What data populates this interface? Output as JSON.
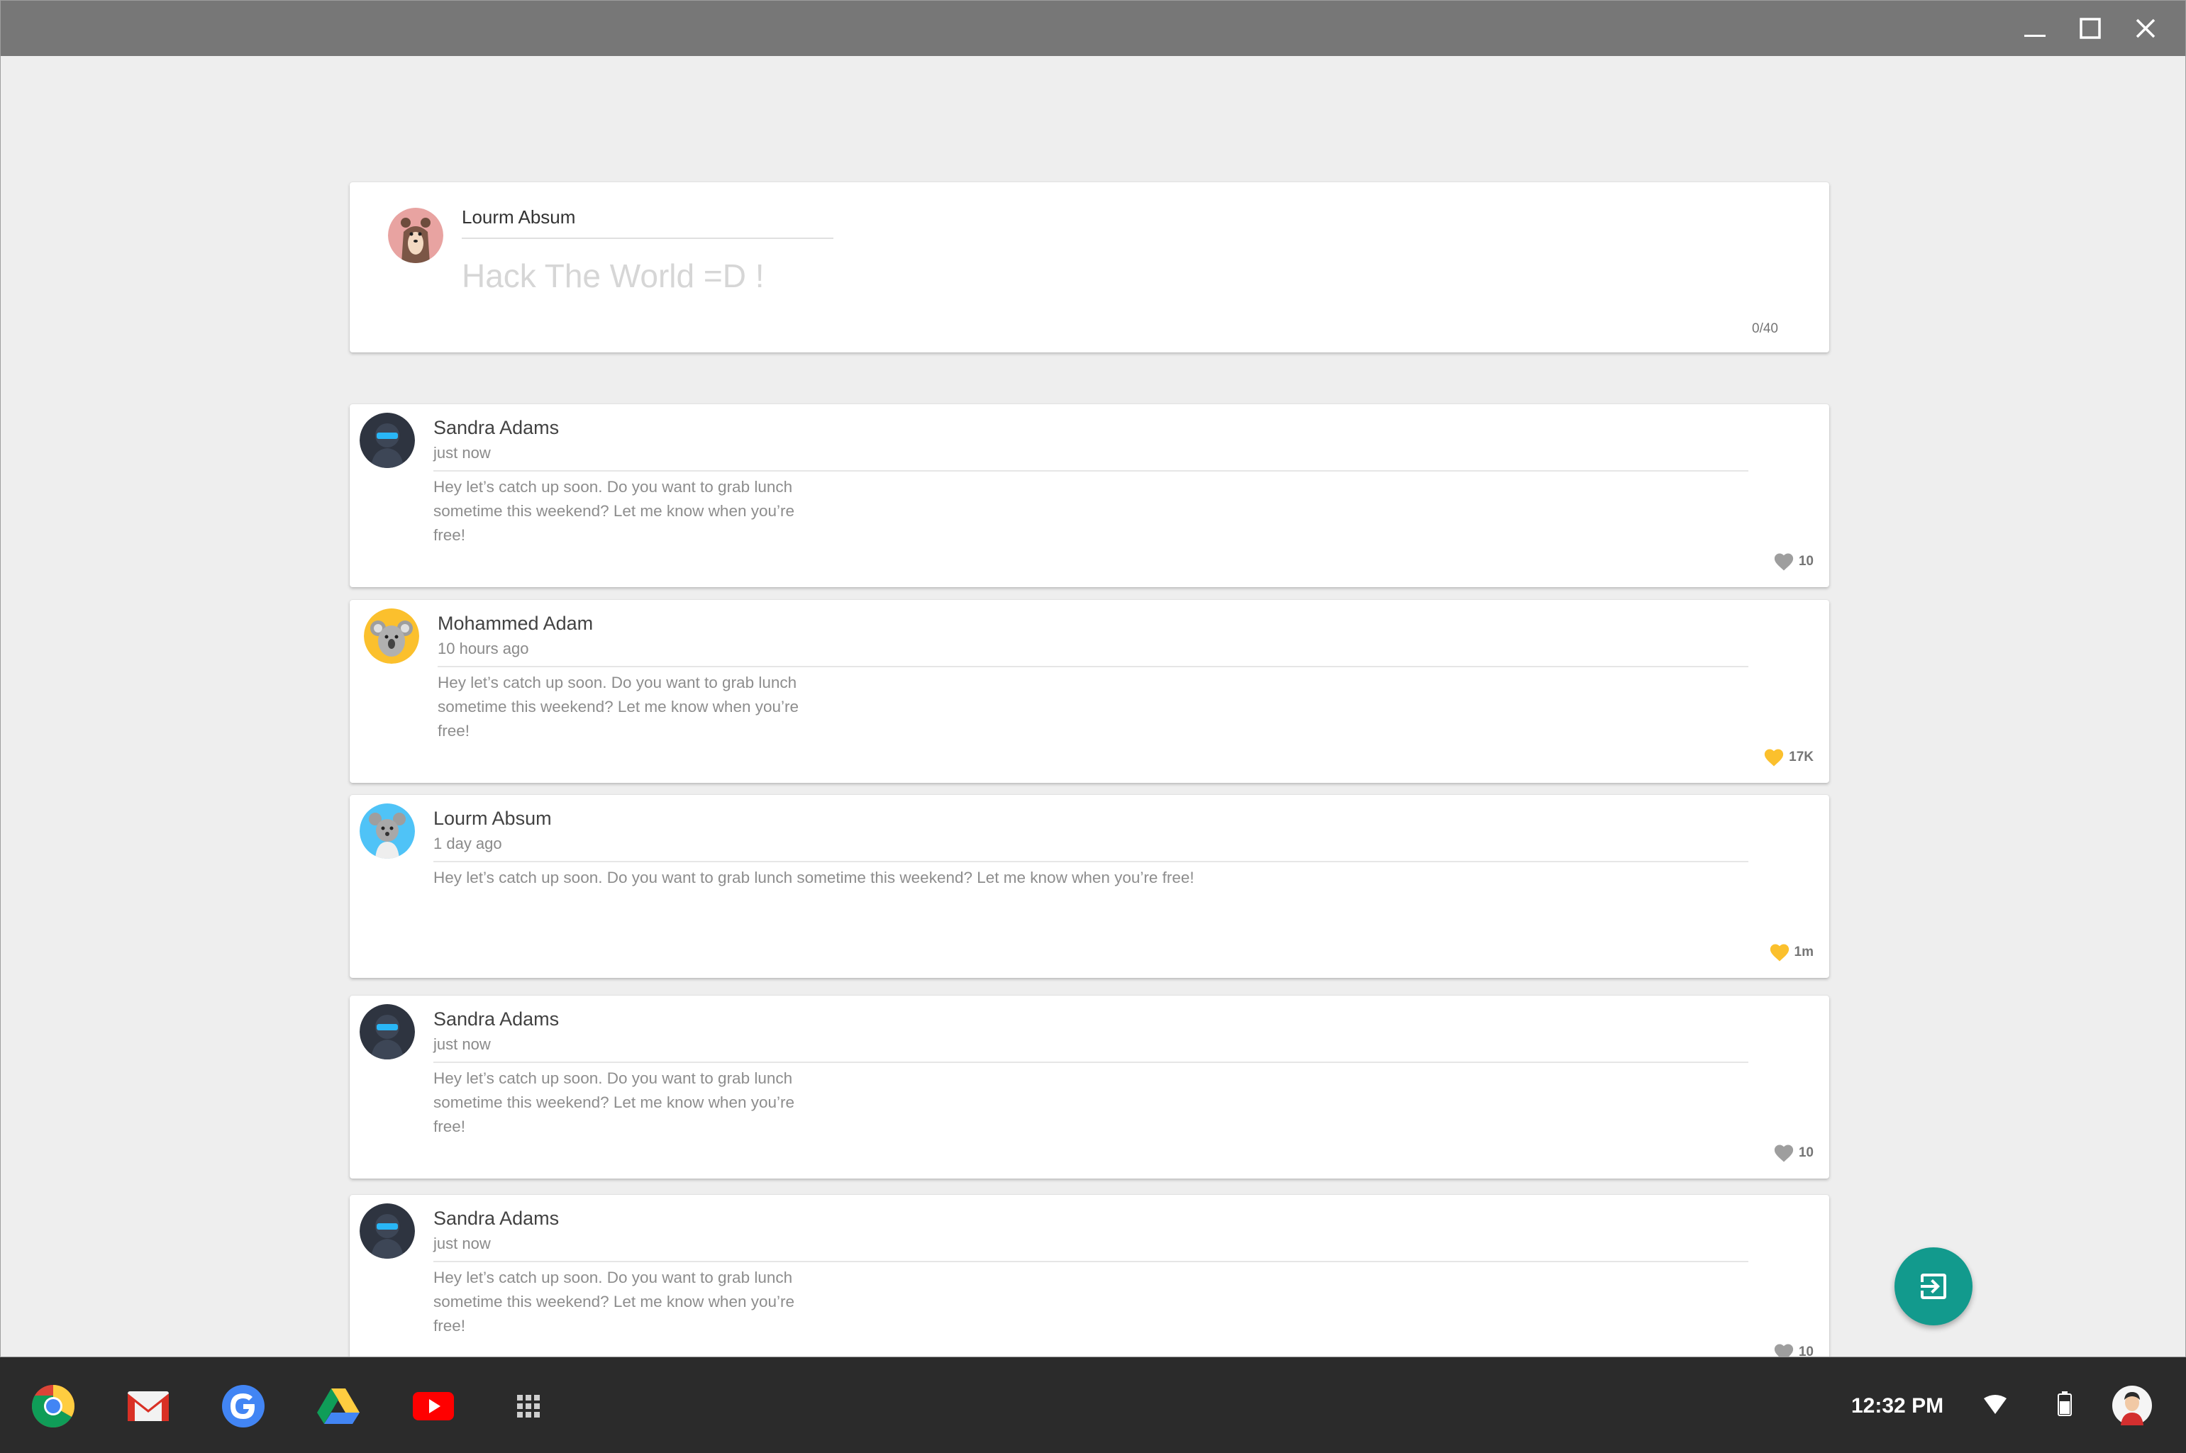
{
  "composer": {
    "user_name": "Lourm Absum",
    "placeholder": "Hack The World =D !",
    "counter": "0/40"
  },
  "posts": [
    {
      "name": "Sandra Adams",
      "time": "just now",
      "body": "Hey let’s catch up soon. Do you want to grab lunch sometime this weekend? Let me know when you’re free!",
      "likes": "10",
      "liked": false,
      "avatar": "ninja"
    },
    {
      "name": "Mohammed Adam",
      "time": "10 hours ago",
      "body": "Hey let’s catch up soon. Do you want to grab lunch sometime this weekend? Let me know when you’re free!",
      "likes": "17K",
      "liked": true,
      "avatar": "koala"
    },
    {
      "name": "Lourm Absum",
      "time": "1 day ago",
      "body": "Hey let’s catch up soon. Do you want to grab   lunch sometime this weekend? Let me know when you’re free!",
      "likes": "1m",
      "liked": true,
      "avatar": "mouse"
    },
    {
      "name": "Sandra Adams",
      "time": "just now",
      "body": "Hey let’s catch up soon. Do you want to grab lunch sometime this weekend? Let me know when you’re free!",
      "likes": "10",
      "liked": false,
      "avatar": "ninja"
    },
    {
      "name": "Sandra Adams",
      "time": "just now",
      "body": "Hey let’s catch up soon. Do you want to grab lunch sometime this weekend? Let me know when you’re free!",
      "likes": "10",
      "liked": false,
      "avatar": "ninja"
    }
  ],
  "colors": {
    "like_active": "#fbc02d",
    "like_inactive": "#9e9e9e",
    "fab": "#129a8d"
  },
  "fab": {
    "icon": "exit-to-app-icon"
  },
  "shelf": {
    "apps": [
      "chrome-icon",
      "gmail-icon",
      "google-icon",
      "drive-icon",
      "youtube-icon",
      "app-launcher-icon"
    ],
    "time": "12:32 PM"
  }
}
